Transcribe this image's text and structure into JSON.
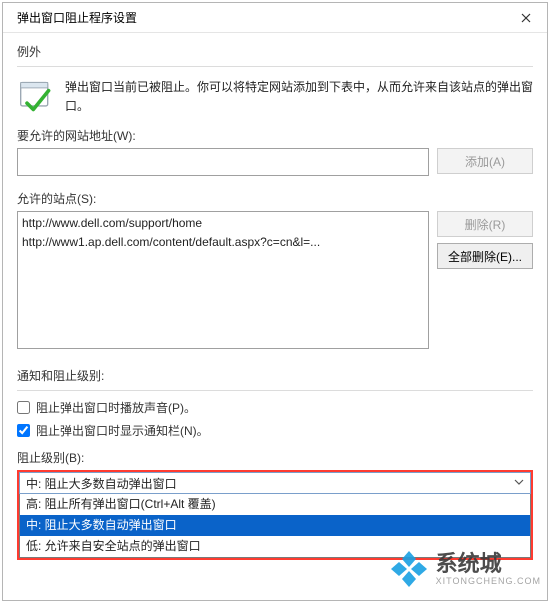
{
  "window": {
    "title": "弹出窗口阻止程序设置"
  },
  "exceptions": {
    "heading": "例外",
    "info": "弹出窗口当前已被阻止。你可以将特定网站添加到下表中，从而允许来自该站点的弹出窗口。",
    "url_label": "要允许的网站地址(W):",
    "url_value": "",
    "add_button": "添加(A)",
    "allowed_label": "允许的站点(S):",
    "allowed_sites": [
      "http://www.dell.com/support/home",
      "http://www1.ap.dell.com/content/default.aspx?c=cn&l=..."
    ],
    "remove_button": "删除(R)",
    "remove_all_button": "全部删除(E)..."
  },
  "notifications": {
    "heading": "通知和阻止级别:",
    "chk_sound": {
      "checked": false,
      "label": "阻止弹出窗口时播放声音(P)。"
    },
    "chk_infobar": {
      "checked": true,
      "label": "阻止弹出窗口时显示通知栏(N)。"
    },
    "level_label": "阻止级别(B):",
    "selected": "中: 阻止大多数自动弹出窗口",
    "options": [
      {
        "label": "高: 阻止所有弹出窗口(Ctrl+Alt 覆盖)",
        "selected": false
      },
      {
        "label": "中: 阻止大多数自动弹出窗口",
        "selected": true
      },
      {
        "label": "低: 允许来自安全站点的弹出窗口",
        "selected": false
      }
    ]
  },
  "watermark": {
    "brand": "系统城",
    "url": "XITONGCHENG.COM"
  }
}
